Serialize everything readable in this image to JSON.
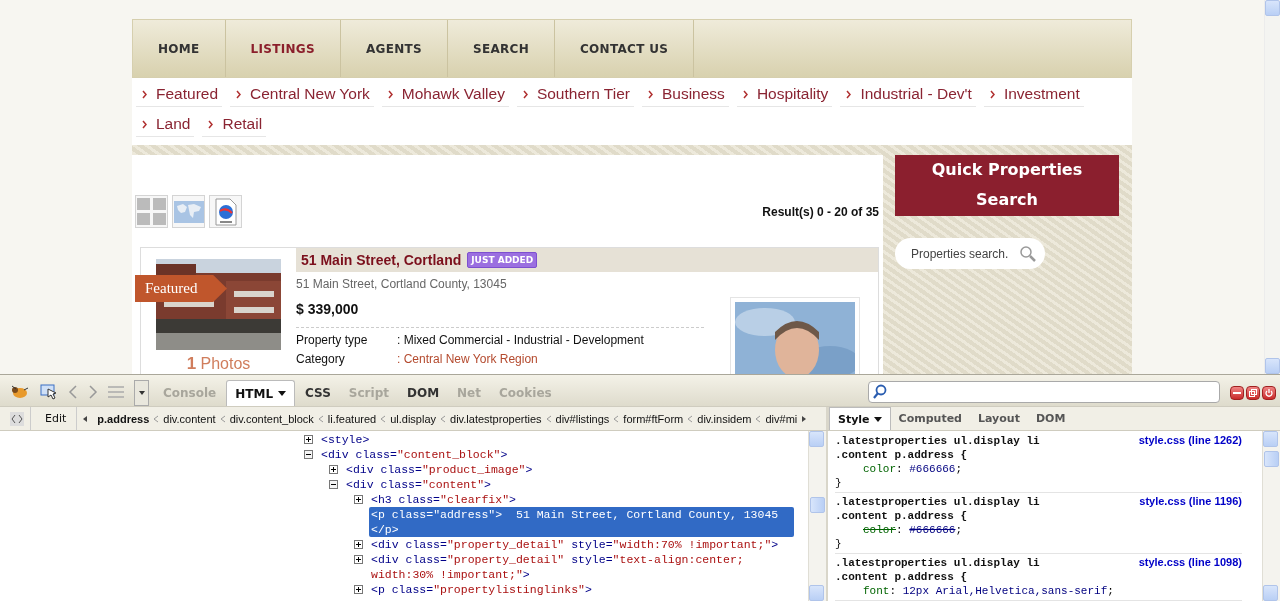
{
  "site": {
    "nav": [
      {
        "label": "HOME",
        "selected": false
      },
      {
        "label": "LISTINGS",
        "selected": true
      },
      {
        "label": "AGENTS",
        "selected": false
      },
      {
        "label": "SEARCH",
        "selected": false
      },
      {
        "label": "CONTACT US",
        "selected": false
      }
    ],
    "categories": [
      "Featured",
      "Central New York",
      "Mohawk Valley",
      "Southern Tier",
      "Business",
      "Hospitality",
      "Industrial - Dev't",
      "Investment",
      "Land",
      "Retail"
    ],
    "results": "Result(s) 0 - 20 of 35",
    "listing": {
      "ribbon": "Featured",
      "photos": "**1** Photos",
      "title": "51 Main Street, Cortland",
      "badge": "JUST ADDED",
      "address": "51 Main Street, Cortland County, 13045",
      "price": "$ 339,000",
      "details": [
        {
          "label": "Property type",
          "value": ": Mixed Commercial - Industrial - Development",
          "kind": "text"
        },
        {
          "label": "Category",
          "value": ": Central New York Region",
          "kind": "link"
        }
      ]
    },
    "sidebar": {
      "heading": "Quick Properties Search",
      "search_placeholder": "Properties search."
    }
  },
  "devtools": {
    "tabs": [
      {
        "label": "Console",
        "selected": false,
        "disabled": true
      },
      {
        "label": "HTML",
        "selected": true,
        "disabled": false
      },
      {
        "label": "CSS",
        "selected": false,
        "disabled": false
      },
      {
        "label": "Script",
        "selected": false,
        "disabled": true
      },
      {
        "label": "DOM",
        "selected": false,
        "disabled": false
      },
      {
        "label": "Net",
        "selected": false,
        "disabled": true
      },
      {
        "label": "Cookies",
        "selected": false,
        "disabled": true
      }
    ],
    "edit": "Edit",
    "breadcrumbs": [
      {
        "label": "p.address",
        "selected": true
      },
      {
        "label": "div.content",
        "selected": false
      },
      {
        "label": "div.content_block",
        "selected": false
      },
      {
        "label": "li.featured",
        "selected": false
      },
      {
        "label": "ul.display",
        "selected": false
      },
      {
        "label": "div.latestproperties",
        "selected": false
      },
      {
        "label": "div#listings",
        "selected": false
      },
      {
        "label": "form#ftForm",
        "selected": false
      },
      {
        "label": "div.insidem",
        "selected": false
      },
      {
        "label": "div#mi",
        "selected": false
      }
    ],
    "tree": [
      {
        "segments": [
          {
            "kind": "tag",
            "text": "<style>"
          }
        ],
        "expanded": false,
        "selected": false
      },
      {
        "segments": [
          {
            "kind": "tag",
            "text": "<div "
          },
          {
            "kind": "attr",
            "text": "class="
          },
          {
            "kind": "value",
            "text": "\"content_block\""
          },
          {
            "kind": "tag",
            "text": ">"
          }
        ],
        "expanded": true,
        "selected": false,
        "children": [
          {
            "segments": [
              {
                "kind": "tag",
                "text": "<div "
              },
              {
                "kind": "attr",
                "text": "class="
              },
              {
                "kind": "value",
                "text": "\"product_image\""
              },
              {
                "kind": "tag",
                "text": ">"
              }
            ],
            "expanded": false,
            "selected": false
          },
          {
            "segments": [
              {
                "kind": "tag",
                "text": "<div "
              },
              {
                "kind": "attr",
                "text": "class="
              },
              {
                "kind": "value",
                "text": "\"content\""
              },
              {
                "kind": "tag",
                "text": ">"
              }
            ],
            "expanded": true,
            "selected": false,
            "children": [
              {
                "segments": [
                  {
                    "kind": "tag",
                    "text": "<h3 "
                  },
                  {
                    "kind": "attr",
                    "text": "class="
                  },
                  {
                    "kind": "value",
                    "text": "\"clearfix\""
                  },
                  {
                    "kind": "tag",
                    "text": ">"
                  }
                ],
                "expanded": false,
                "selected": false
              },
              {
                "segments": [
                  {
                    "kind": "tag",
                    "text": "<p "
                  },
                  {
                    "kind": "attr",
                    "text": "class="
                  },
                  {
                    "kind": "value",
                    "text": "\"address\""
                  },
                  {
                    "kind": "tag",
                    "text": ">"
                  },
                  {
                    "kind": "text",
                    "text": "  51 Main Street, Cortland County, 13045"
                  },
                  {
                    "kind": "close",
                    "text": "</p>"
                  }
                ],
                "selected": true
              },
              {
                "segments": [
                  {
                    "kind": "tag",
                    "text": "<div "
                  },
                  {
                    "kind": "attr",
                    "text": "class="
                  },
                  {
                    "kind": "value",
                    "text": "\"property_detail\""
                  },
                  {
                    "kind": "attr",
                    "text": " style="
                  },
                  {
                    "kind": "value",
                    "text": "\"width:70% !important;\""
                  },
                  {
                    "kind": "tag",
                    "text": ">"
                  }
                ],
                "expanded": false,
                "selected": false
              },
              {
                "segments": [
                  {
                    "kind": "tag",
                    "text": "<div "
                  },
                  {
                    "kind": "attr",
                    "text": "class="
                  },
                  {
                    "kind": "value",
                    "text": "\"property_detail\""
                  },
                  {
                    "kind": "attr",
                    "text": " style="
                  },
                  {
                    "kind": "value",
                    "text": "\"text-align:center; width:30% !important;\""
                  },
                  {
                    "kind": "tag",
                    "text": ">"
                  }
                ],
                "expanded": false,
                "selected": false
              },
              {
                "segments": [
                  {
                    "kind": "tag",
                    "text": "<p "
                  },
                  {
                    "kind": "attr",
                    "text": "class="
                  },
                  {
                    "kind": "value",
                    "text": "\"propertylistinglinks\""
                  },
                  {
                    "kind": "tag",
                    "text": ">"
                  }
                ],
                "expanded": false,
                "selected": false
              }
            ]
          }
        ]
      }
    ],
    "side_tabs": [
      {
        "label": "Style",
        "selected": true
      },
      {
        "label": "Computed",
        "selected": false
      },
      {
        "label": "Layout",
        "selected": false
      },
      {
        "label": "DOM",
        "selected": false
      }
    ],
    "rules": [
      {
        "selector": [
          ".latestproperties ul.display li",
          ".content p.address {"
        ],
        "source": "style.css (line 1262)",
        "declarations": [
          {
            "property": "color",
            "sep": ":",
            "value": "#666666",
            "end": ";",
            "overridden": false
          }
        ],
        "close": "}"
      },
      {
        "selector": [
          ".latestproperties ul.display li",
          ".content p.address {"
        ],
        "source": "style.css (line 1196)",
        "declarations": [
          {
            "property": "color",
            "sep": ":",
            "value": "#666666",
            "end": ";",
            "overridden": true
          }
        ],
        "close": "}"
      },
      {
        "selector": [
          ".latestproperties ul.display li",
          ".content p.address {"
        ],
        "source": "style.css (line 1098)",
        "declarations": [
          {
            "property": "font",
            "sep": ":",
            "value": "12px Arial,Helvetica,sans-serif",
            "end": ";",
            "overridden": false
          }
        ]
      }
    ]
  }
}
